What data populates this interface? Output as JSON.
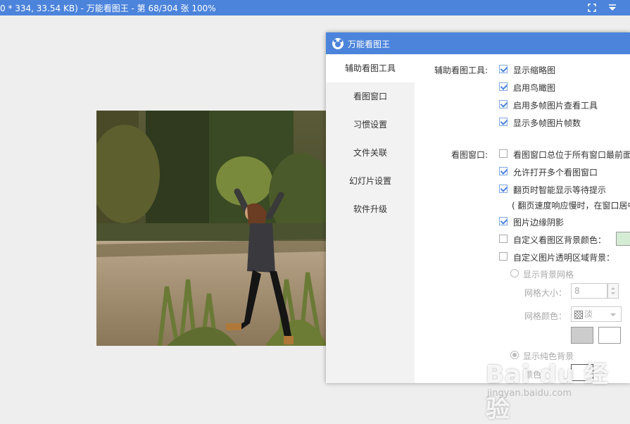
{
  "viewer": {
    "title": "0 * 334, 33.54 KB) - 万能看图王 - 第 68/304 张 100%",
    "watermark_big": "Bai du 经验",
    "watermark_small": "jingyan.baidu.com"
  },
  "dialog": {
    "title": "万能看图王",
    "nav": [
      {
        "label": "辅助看图工具",
        "active": true
      },
      {
        "label": "看图窗口"
      },
      {
        "label": "习惯设置"
      },
      {
        "label": "文件关联"
      },
      {
        "label": "幻灯片设置"
      },
      {
        "label": "软件升级"
      }
    ],
    "tools": {
      "section_label": "辅助看图工具:",
      "options": [
        {
          "label": "显示缩略图",
          "checked": true
        },
        {
          "label": "启用鸟瞰图",
          "checked": true
        },
        {
          "label": "启用多帧图片查看工具",
          "checked": true
        },
        {
          "label": "显示多帧图片帧数",
          "checked": true
        }
      ]
    },
    "window": {
      "section_label": "看图窗口:",
      "options": [
        {
          "label": "看图窗口总位于所有窗口最前面",
          "checked": false
        },
        {
          "label": "允许打开多个看图窗口",
          "checked": true
        },
        {
          "label": "翻页时智能显示等待提示",
          "checked": true
        }
      ],
      "note": "( 翻页速度响应慢时，在窗口居中",
      "options2": [
        {
          "label": "图片边缘阴影",
          "checked": true
        },
        {
          "label": "自定义看图区背景颜色：",
          "checked": false
        },
        {
          "label": "自定义图片透明区域背景：",
          "checked": false
        }
      ],
      "radio_grid": "显示背景网格",
      "grid_size_label": "网格大小：",
      "grid_size_value": "8",
      "grid_color_label": "网格颜色：",
      "grid_color_value": "淡",
      "radio_solid": "显示纯色背景",
      "solid_label": "颜色"
    },
    "colors": {
      "accent": "#4c84dc",
      "bg_swatch": "#d4ecd4",
      "swatch_gray": "#cccccc",
      "swatch_white": "#ffffff"
    }
  }
}
